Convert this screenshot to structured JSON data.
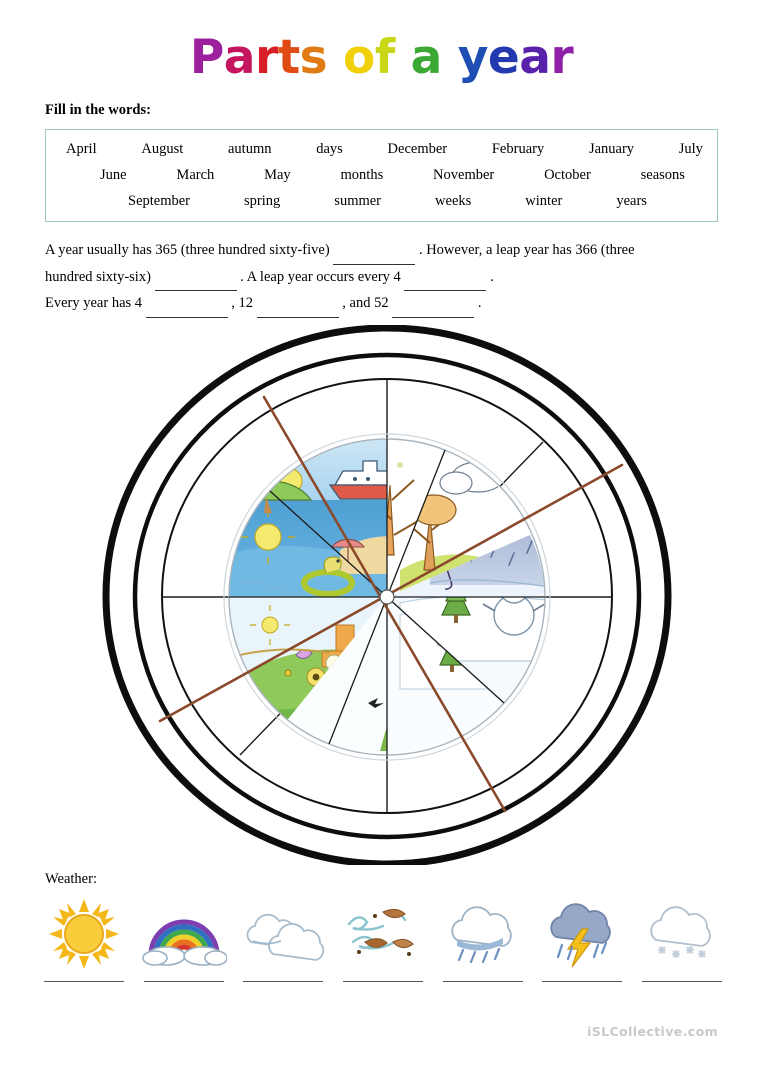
{
  "title": {
    "text": "Parts of a year",
    "letters": [
      {
        "c": "P",
        "color": "#9c1f9c"
      },
      {
        "c": "a",
        "color": "#c4155e"
      },
      {
        "c": "r",
        "color": "#d81e28"
      },
      {
        "c": "t",
        "color": "#e04a15"
      },
      {
        "c": "s",
        "color": "#e07a12"
      },
      {
        "c": " ",
        "color": "#000000"
      },
      {
        "c": "o",
        "color": "#f0d007"
      },
      {
        "c": "f",
        "color": "#c8d817"
      },
      {
        "c": " ",
        "color": "#000000"
      },
      {
        "c": "a",
        "color": "#3aa832"
      },
      {
        "c": " ",
        "color": "#000000"
      },
      {
        "c": "y",
        "color": "#1f4fb4"
      },
      {
        "c": "e",
        "color": "#2438b0"
      },
      {
        "c": "a",
        "color": "#5a21ab"
      },
      {
        "c": "r",
        "color": "#8e1fa8"
      }
    ]
  },
  "instruction": "Fill in the words:",
  "word_bank": {
    "border_color": "#9fc9b7",
    "rows": [
      [
        "April",
        "August",
        "autumn",
        "days",
        "December",
        "February",
        "January",
        "July"
      ],
      [
        "June",
        "March",
        "May",
        "months",
        "November",
        "October",
        "seasons"
      ],
      [
        "September",
        "spring",
        "summer",
        "weeks",
        "winter",
        "years"
      ]
    ]
  },
  "paragraph": {
    "line1_a": "A year usually has 365 (three hundred sixty-five)",
    "line1_b": ". However, a leap year has 366 (three",
    "line2_a": "hundred sixty-six)",
    "line2_b": ". A leap year occurs every 4",
    "line2_c": ".",
    "line3_a": "Every year has 4",
    "line3_b": ", 12",
    "line3_c": ", and 52",
    "line3_d": "."
  },
  "wheel": {
    "label": "seasons-wheel-diagram",
    "ring_color": "#111111",
    "spoke_color": "#1a1a1a",
    "diagonal_color": "#8b4a2b",
    "sectors": [
      {
        "name": "autumn-falling-leaves",
        "season": "autumn",
        "scene": "bare tree with falling orange leaves"
      },
      {
        "name": "autumn-rain-umbrella",
        "season": "autumn",
        "scene": "rain clouds with purple umbrella"
      },
      {
        "name": "winter-snowman",
        "season": "winter",
        "scene": "snowman and fir tree on snow"
      },
      {
        "name": "winter-snow-house",
        "season": "winter",
        "scene": "snowfall over orange house and fir tree"
      },
      {
        "name": "winter-frozen-lake",
        "season": "winter",
        "scene": "frozen lake with mountains and fir trees"
      },
      {
        "name": "spring-blossom-tree",
        "season": "spring",
        "scene": "blossoming tree, birds and flowers on green hills"
      },
      {
        "name": "spring-flowers",
        "season": "spring",
        "scene": "flowers, butterfly and bee on meadow"
      },
      {
        "name": "summer-beach",
        "season": "summer",
        "scene": "sun, sea, boat, parasol and swim ring"
      }
    ]
  },
  "weather": {
    "label": "Weather:",
    "items": [
      {
        "icon": "sun-icon",
        "name": "sunny"
      },
      {
        "icon": "rainbow-icon",
        "name": "rainbow"
      },
      {
        "icon": "cloud-icon",
        "name": "cloudy"
      },
      {
        "icon": "wind-icon",
        "name": "windy"
      },
      {
        "icon": "rain-cloud-icon",
        "name": "rainy"
      },
      {
        "icon": "thunderstorm-icon",
        "name": "stormy"
      },
      {
        "icon": "snow-cloud-icon",
        "name": "snowy"
      }
    ]
  },
  "footer": {
    "watermark": "iSLCollective.com",
    "watermark_color": "#c9c9c9"
  }
}
